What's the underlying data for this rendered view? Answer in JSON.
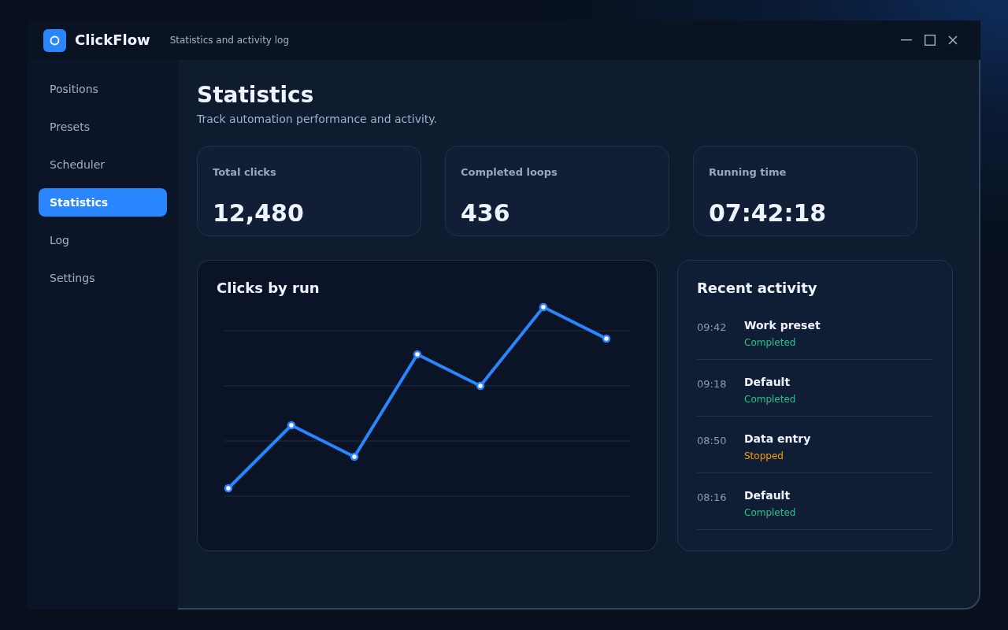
{
  "window": {
    "app_name": "ClickFlow",
    "subtitle": "Statistics and activity log"
  },
  "sidebar": {
    "items": [
      {
        "label": "Positions",
        "selected": false
      },
      {
        "label": "Presets",
        "selected": false
      },
      {
        "label": "Scheduler",
        "selected": false
      },
      {
        "label": "Statistics",
        "selected": true
      },
      {
        "label": "Log",
        "selected": false
      },
      {
        "label": "Settings",
        "selected": false
      }
    ]
  },
  "header": {
    "title": "Statistics",
    "subtitle": "Track automation performance and activity."
  },
  "stats": [
    {
      "label": "Total clicks",
      "value": "12,480"
    },
    {
      "label": "Completed loops",
      "value": "436"
    },
    {
      "label": "Running time",
      "value": "07:42:18"
    }
  ],
  "chart": {
    "title": "Clicks by run"
  },
  "activity": {
    "title": "Recent activity",
    "items": [
      {
        "time": "09:42",
        "name": "Work preset",
        "status": "Completed",
        "color": "#22c38a"
      },
      {
        "time": "09:18",
        "name": "Default",
        "status": "Completed",
        "color": "#22c38a"
      },
      {
        "time": "08:50",
        "name": "Data entry",
        "status": "Stopped",
        "color": "#f59e0b"
      },
      {
        "time": "08:16",
        "name": "Default",
        "status": "Completed",
        "color": "#22c38a"
      }
    ]
  }
}
